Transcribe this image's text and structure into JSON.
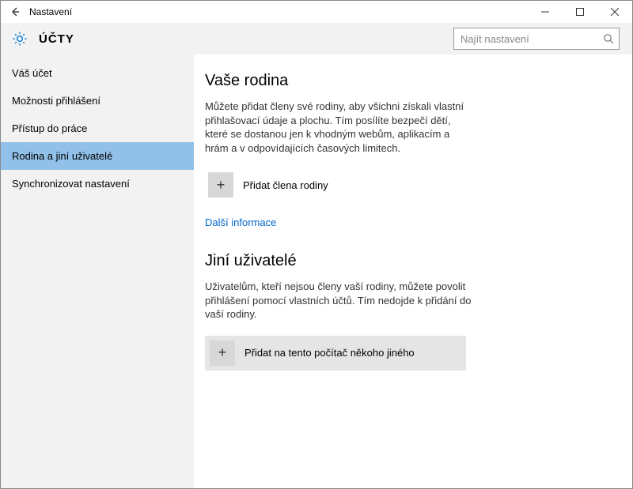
{
  "titlebar": {
    "title": "Nastavení"
  },
  "header": {
    "title": "ÚČTY",
    "search_placeholder": "Najít nastavení"
  },
  "sidebar": {
    "items": [
      {
        "label": "Váš účet"
      },
      {
        "label": "Možnosti přihlášení"
      },
      {
        "label": "Přístup do práce"
      },
      {
        "label": "Rodina a jiní uživatelé"
      },
      {
        "label": "Synchronizovat nastavení"
      }
    ],
    "selected_index": 3
  },
  "content": {
    "section1": {
      "title": "Vaše rodina",
      "text": "Můžete přidat členy své rodiny, aby všichni získali vlastní přihlašovací údaje a plochu. Tím posílíte bezpečí dětí, které se dostanou jen k vhodným webům, aplikacím a hrám a v odpovídajících časových limitech.",
      "add_label": "Přidat člena rodiny",
      "link": "Další informace"
    },
    "section2": {
      "title": "Jiní uživatelé",
      "text": "Uživatelům, kteří nejsou členy vaší rodiny, můžete povolit přihlášení pomocí vlastních účtů. Tím nedojde k přidání do vaší rodiny.",
      "add_label": "Přidat na tento počítač někoho jiného"
    }
  }
}
